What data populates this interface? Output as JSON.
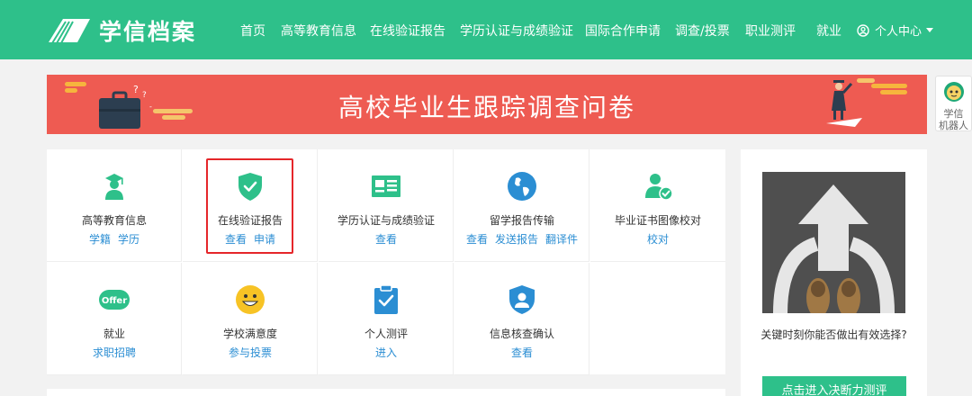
{
  "header": {
    "brand": "学信档案",
    "nav": [
      "首页",
      "高等教育信息",
      "在线验证报告",
      "学历认证与成绩验证",
      "国际合作申请",
      "调查/投票",
      "职业测评",
      "就业"
    ],
    "user_menu": "个人中心"
  },
  "banner": {
    "title": "高校毕业生跟踪调查问卷"
  },
  "robot": {
    "label_line1": "学信",
    "label_line2": "机器人"
  },
  "services": [
    {
      "title": "高等教育信息",
      "icon": "graduate-icon",
      "links": [
        "学籍",
        "学历"
      ]
    },
    {
      "title": "在线验证报告",
      "icon": "shield-check-icon",
      "links": [
        "查看",
        "申请"
      ]
    },
    {
      "title": "学历认证与成绩验证",
      "icon": "id-card-icon",
      "links": [
        "查看"
      ]
    },
    {
      "title": "留学报告传输",
      "icon": "globe-icon",
      "links": [
        "查看",
        "发送报告",
        "翻译件"
      ]
    },
    {
      "title": "毕业证书图像校对",
      "icon": "user-check-icon",
      "links": [
        "校对"
      ]
    },
    {
      "title": "就业",
      "icon": "offer-icon",
      "icon_text": "Offer",
      "links": [
        "求职招聘"
      ]
    },
    {
      "title": "学校满意度",
      "icon": "smiley-icon",
      "links": [
        "参与投票"
      ]
    },
    {
      "title": "个人测评",
      "icon": "clipboard-check-icon",
      "links": [
        "进入"
      ]
    },
    {
      "title": "信息核查确认",
      "icon": "user-shield-icon",
      "links": [
        "查看"
      ]
    }
  ],
  "side_ad": {
    "text": "关键时刻你能否做出有效选择?",
    "button": "点击进入决断力测评"
  },
  "colors": {
    "primary": "#2ec08a",
    "banner": "#ee5b52",
    "link": "#2b8ed3",
    "highlight": "#e5262a"
  }
}
